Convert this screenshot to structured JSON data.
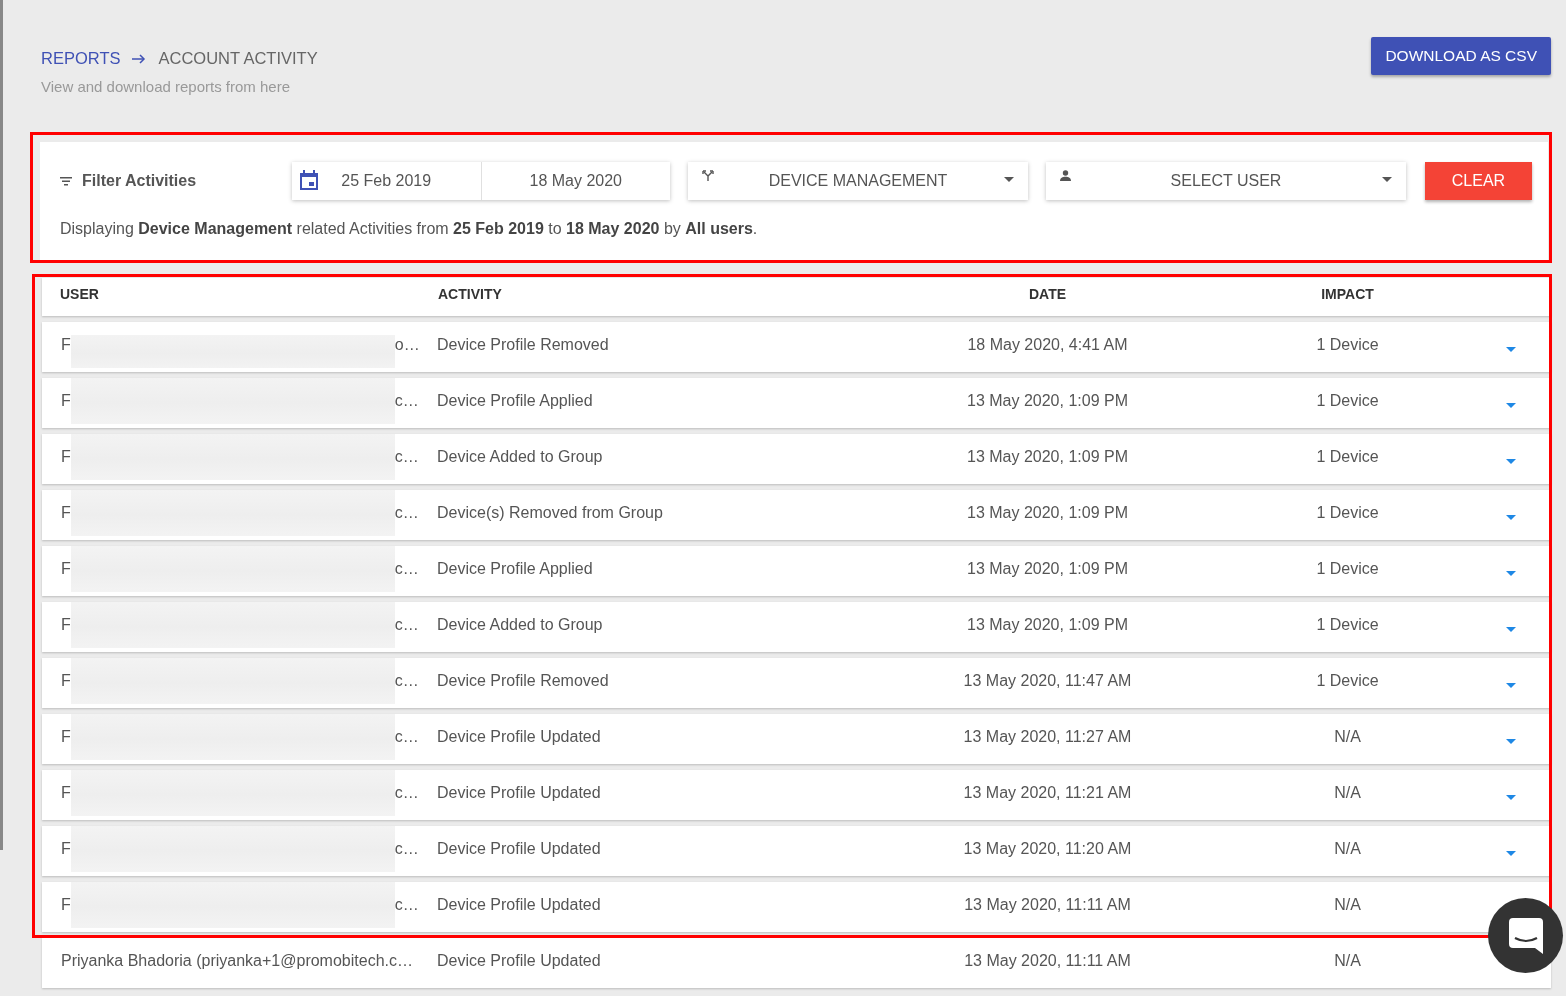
{
  "breadcrumb": {
    "parent": "REPORTS",
    "current": "ACCOUNT ACTIVITY"
  },
  "subtitle": "View and download reports from here",
  "download_button": "DOWNLOAD AS CSV",
  "filter": {
    "title": "Filter Activities",
    "date_from": "25 Feb 2019",
    "date_to": "18 May 2020",
    "category": "DEVICE MANAGEMENT",
    "user_select": "SELECT USER",
    "clear_button": "CLEAR",
    "summary": "Displaying **Device Management** related Activities from **25 Feb 2019** to **18 May 2020** by **All users**."
  },
  "table": {
    "columns": [
      "USER",
      "ACTIVITY",
      "DATE",
      "IMPACT"
    ],
    "rows": [
      {
        "user": "F",
        "user_end": "o…",
        "activity": "Device Profile Removed",
        "date": "18 May 2020, 4:41 AM",
        "impact": "1 Device"
      },
      {
        "user": "F",
        "user_end": "c…",
        "activity": "Device Profile Applied",
        "date": "13 May 2020, 1:09 PM",
        "impact": "1 Device"
      },
      {
        "user": "F",
        "user_end": "c…",
        "activity": "Device Added to Group",
        "date": "13 May 2020, 1:09 PM",
        "impact": "1 Device"
      },
      {
        "user": "F",
        "user_end": "c…",
        "activity": "Device(s) Removed from Group",
        "date": "13 May 2020, 1:09 PM",
        "impact": "1 Device"
      },
      {
        "user": "F",
        "user_end": "c…",
        "activity": "Device Profile Applied",
        "date": "13 May 2020, 1:09 PM",
        "impact": "1 Device"
      },
      {
        "user": "F",
        "user_end": "c…",
        "activity": "Device Added to Group",
        "date": "13 May 2020, 1:09 PM",
        "impact": "1 Device"
      },
      {
        "user": "F",
        "user_end": "c…",
        "activity": "Device Profile Removed",
        "date": "13 May 2020, 11:47 AM",
        "impact": "1 Device"
      },
      {
        "user": "F",
        "user_end": "c…",
        "activity": "Device Profile Updated",
        "date": "13 May 2020, 11:27 AM",
        "impact": "N/A"
      },
      {
        "user": "F",
        "user_end": "c…",
        "activity": "Device Profile Updated",
        "date": "13 May 2020, 11:21 AM",
        "impact": "N/A"
      },
      {
        "user": "F",
        "user_end": "c…",
        "activity": "Device Profile Updated",
        "date": "13 May 2020, 11:20 AM",
        "impact": "N/A"
      },
      {
        "user": "F",
        "user_end": "c…",
        "activity": "Device Profile Updated",
        "date": "13 May 2020, 11:11 AM",
        "impact": "N/A"
      },
      {
        "user": "Priyanka Bhadoria (priyanka+1@promobitech.c…",
        "activity": "Device Profile Updated",
        "date": "13 May 2020, 11:11 AM",
        "impact": "N/A"
      }
    ]
  }
}
